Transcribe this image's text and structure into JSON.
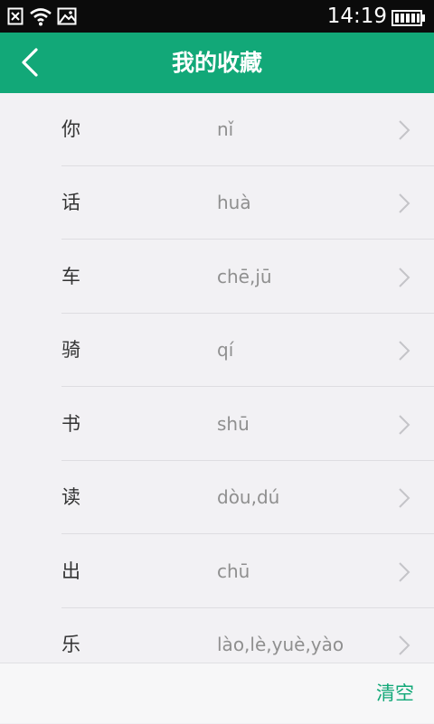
{
  "status_bar": {
    "time": "14:19",
    "icons": [
      "notification-close-icon",
      "wifi-icon",
      "gallery-icon",
      "battery-icon"
    ]
  },
  "header": {
    "title": "我的收藏",
    "back_icon": "chevron-left-icon",
    "background": "#12a878"
  },
  "favorites": [
    {
      "char": "你",
      "pinyin": "nǐ"
    },
    {
      "char": "话",
      "pinyin": "huà"
    },
    {
      "char": "车",
      "pinyin": "chē,jū"
    },
    {
      "char": "骑",
      "pinyin": "qí"
    },
    {
      "char": "书",
      "pinyin": "shū"
    },
    {
      "char": "读",
      "pinyin": "dòu,dú"
    },
    {
      "char": "出",
      "pinyin": "chū"
    },
    {
      "char": "乐",
      "pinyin": "lào,lè,yuè,yào"
    }
  ],
  "footer": {
    "clear_label": "清空",
    "accent": "#12a878"
  }
}
